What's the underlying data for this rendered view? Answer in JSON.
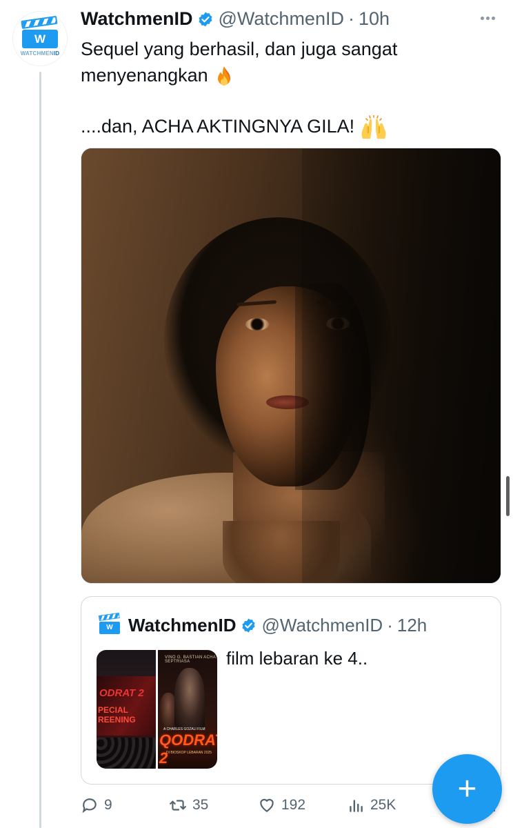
{
  "tweet": {
    "author": {
      "display_name": "WatchmenID",
      "handle": "@WatchmenID",
      "time": "10h",
      "avatar_letter": "W",
      "avatar_brand_prefix": "WATCHMEN",
      "avatar_brand_suffix": "ID",
      "verified": true
    },
    "separator": "·",
    "text_line1": "Sequel yang berhasil, dan juga sangat",
    "text_line2": "menyenangkan",
    "text_line2_emoji": "fire-emoji",
    "text_line3": "....dan, ACHA AKTINGNYA GILA!",
    "text_line3_emoji": "raising-hands-emoji"
  },
  "quoted_tweet": {
    "display_name": "WatchmenID",
    "handle": "@WatchmenID",
    "time": "12h",
    "avatar_letter": "W",
    "text": "film lebaran ke 4..",
    "thumbnail1": {
      "title": "ODRAT 2",
      "caption": "PECIAL\nREENING"
    },
    "thumbnail2": {
      "top_caption": "VINO G. BASTIAN   ACHA SEPTRIASA",
      "credit": "A CHARLES GOZALI FILM",
      "title": "QODRAT 2",
      "subtitle": "DI BIOSKOP LEBARAN 2025"
    }
  },
  "actions": {
    "replies": "9",
    "retweets": "35",
    "likes": "192",
    "views": "25K"
  },
  "fab": {
    "label": "+"
  },
  "colors": {
    "accent": "#1d9bf0",
    "text_primary": "#0f1419",
    "text_secondary": "#536471",
    "border": "#cfd9de"
  }
}
